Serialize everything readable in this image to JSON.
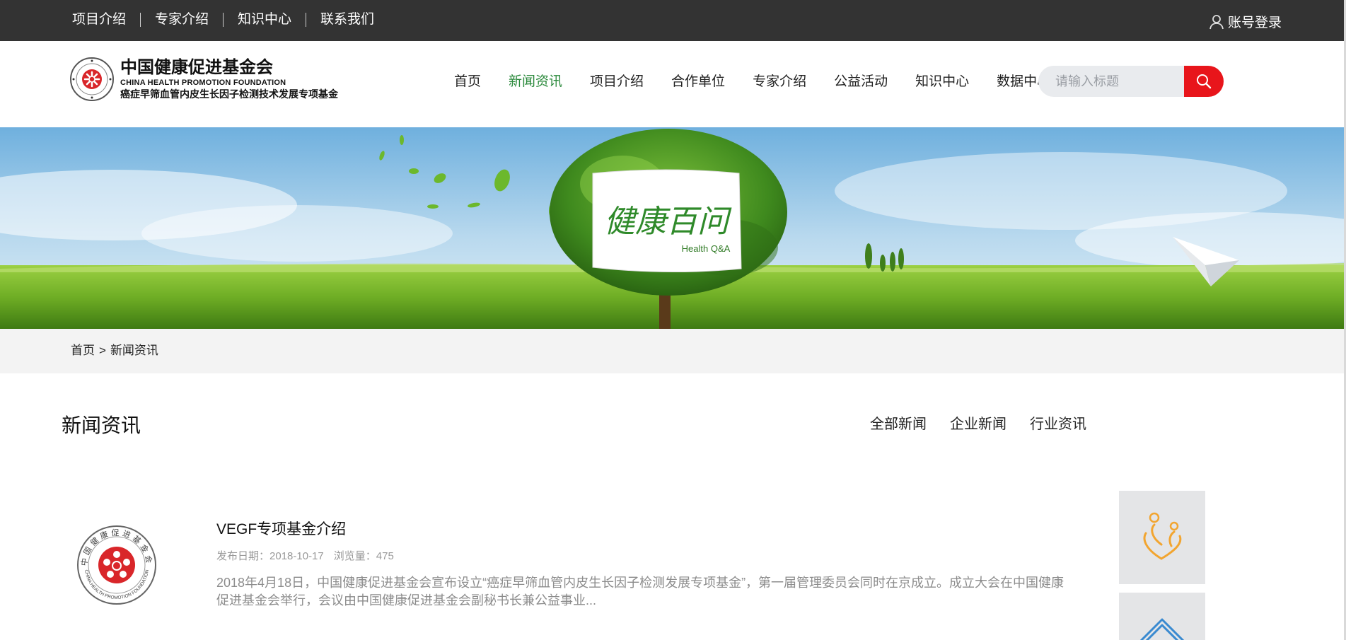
{
  "topbar": {
    "links": [
      "项目介绍",
      "专家介绍",
      "知识中心",
      "联系我们"
    ],
    "login_label": "账号登录"
  },
  "logo": {
    "cn_name": "中国健康促进基金会",
    "en_name": "CHINA HEALTH PROMOTION FOUNDATION",
    "sub_name": "癌症早筛血管内皮生长因子检测技术发展专项基金",
    "seal_text": "中国健康促进基金会"
  },
  "nav": {
    "items": [
      "首页",
      "新闻资讯",
      "项目介绍",
      "合作单位",
      "专家介绍",
      "公益活动",
      "知识中心",
      "数据中心"
    ],
    "active_index": 1
  },
  "search": {
    "placeholder": "请输入标题",
    "value": ""
  },
  "banner": {
    "sign_cn": "健康百问",
    "sign_en": "Health Q&A"
  },
  "breadcrumb": {
    "home": "首页",
    "separator": ">",
    "current": "新闻资讯"
  },
  "section": {
    "title": "新闻资讯",
    "tabs": [
      "全部新闻",
      "企业新闻",
      "行业资讯"
    ]
  },
  "news": [
    {
      "title": "VEGF专项基金介绍",
      "date_label": "发布日期：",
      "date": "2018-10-17",
      "views_label": "浏览量：",
      "views": "475",
      "summary": "2018年4月18日，中国健康促进基金会宣布设立“癌症早筛血管内皮生长因子检测发展专项基金”，第一届管理委员会同时在京成立。成立大会在中国健康促进基金会举行，会议由中国健康促进基金会副秘书长兼公益事业...",
      "seal_en": "CHINA HEALTH PROMOTION FOUNDATION"
    }
  ],
  "side_icons": [
    "family-heart-icon",
    "house-icon"
  ],
  "colors": {
    "topbar_bg": "#333333",
    "nav_active": "#2c8a3d",
    "search_button": "#e8151b",
    "search_bg": "#e9ebee",
    "breadcrumb_bg": "#f3f3f3",
    "side_icon_orange": "#f2a530",
    "side_icon_blue": "#3a8ad0"
  }
}
